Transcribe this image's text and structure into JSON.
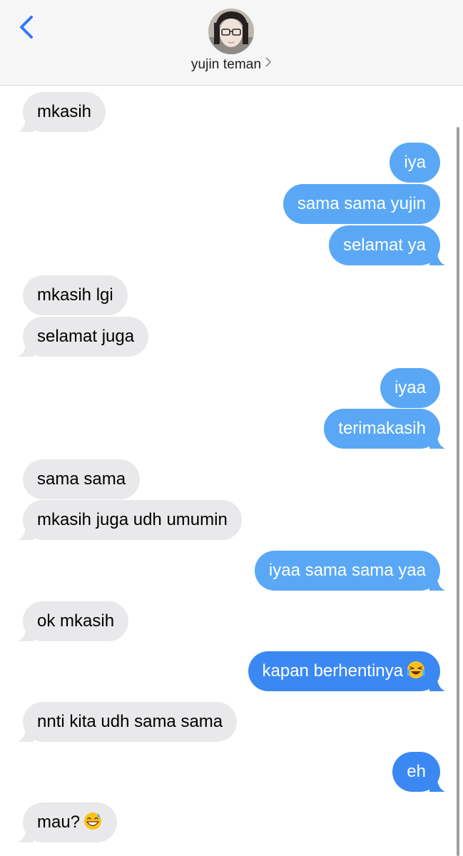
{
  "header": {
    "contact_name": "yujin teman",
    "back_icon": "chevron-left-icon",
    "avatar": "contact-avatar"
  },
  "colors": {
    "incoming_bubble": "#e9e9eb",
    "outgoing_bubble": "#5aa8f5",
    "outgoing_bubble_latest": "#3b88f3",
    "accent": "#3478f6"
  },
  "messages": [
    {
      "from": "contact",
      "text": "mkasih"
    },
    {
      "from": "me",
      "text": "iya"
    },
    {
      "from": "me",
      "text": "sama sama yujin"
    },
    {
      "from": "me",
      "text": "selamat ya"
    },
    {
      "from": "contact",
      "text": "mkasih lgi"
    },
    {
      "from": "contact",
      "text": "selamat juga"
    },
    {
      "from": "me",
      "text": "iyaa"
    },
    {
      "from": "me",
      "text": "terimakasih"
    },
    {
      "from": "contact",
      "text": "sama sama"
    },
    {
      "from": "contact",
      "text": "mkasih juga udh umumin"
    },
    {
      "from": "me",
      "text": "iyaa sama sama yaa"
    },
    {
      "from": "contact",
      "text": "ok mkasih"
    },
    {
      "from": "me",
      "text": "kapan berhentinya",
      "emoji": "tears-of-joy-emoji"
    },
    {
      "from": "contact",
      "text": "nnti kita udh sama sama"
    },
    {
      "from": "me",
      "text": "eh"
    },
    {
      "from": "contact",
      "text": "mau?",
      "emoji": "grinning-sweat-emoji"
    }
  ]
}
